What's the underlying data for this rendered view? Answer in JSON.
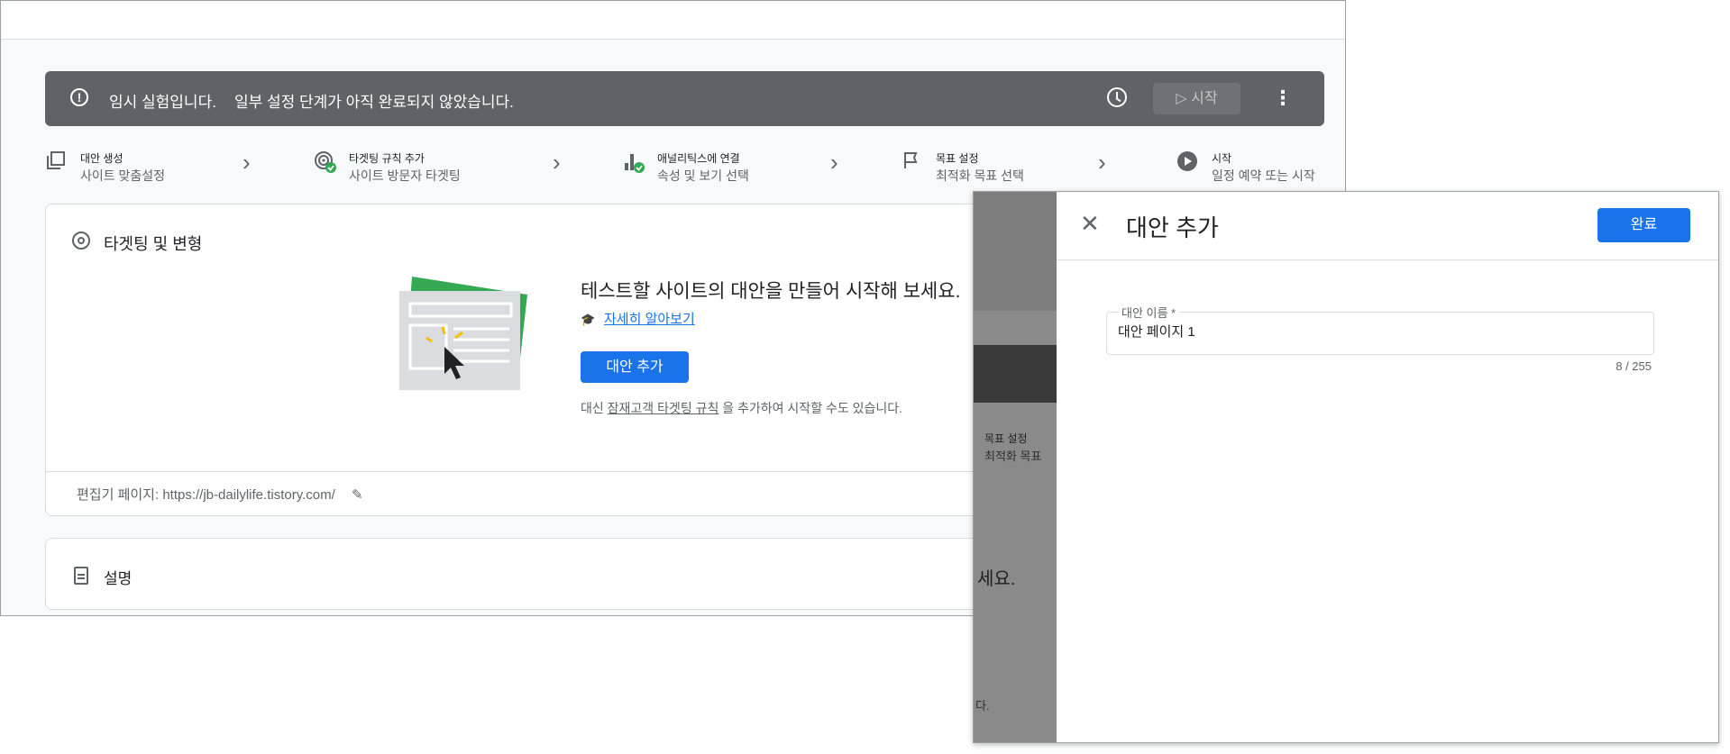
{
  "banner": {
    "message": "임시 실험입니다.",
    "message_detail": "일부 설정 단계가 아직 완료되지 않았습니다.",
    "start_label": "▷ 시작",
    "colors": {
      "background": "#5f6368"
    }
  },
  "steps": [
    {
      "title": "대안 생성",
      "subtitle": "사이트 맞춤설정",
      "icon": "copy-icon"
    },
    {
      "title": "타겟팅 규칙 추가",
      "subtitle": "사이트 방문자 타겟팅",
      "icon": "target-check-icon"
    },
    {
      "title": "애널리틱스에 연결",
      "subtitle": "속성 및 보기 선택",
      "icon": "analytics-check-icon"
    },
    {
      "title": "목표 설정",
      "subtitle": "최적화 목표 선택",
      "icon": "flag-icon"
    },
    {
      "title": "시작",
      "subtitle": "일정 예약 또는 시작",
      "icon": "play-circle-icon"
    }
  ],
  "targeting_card": {
    "title": "타겟팅 및 변형",
    "prompt": "테스트할 사이트의 대안을 만들어 시작해 보세요.",
    "learn_more": "자세히 알아보기",
    "add_button": "대안 추가",
    "alt_prefix": "대신",
    "alt_link": "잠재고객 타겟팅 규칙",
    "alt_suffix": "을 추가하여 시작할 수도 있습니다.",
    "editor_label": "편집기 페이지:",
    "editor_url": "https://jb-dailylife.tistory.com/"
  },
  "description_card": {
    "title": "설명"
  },
  "background_fragments": {
    "step_title": "목표 설정",
    "step_subtitle": "최적화 목표",
    "prompt_tail": "세요.",
    "text_tail": "다."
  },
  "dialog": {
    "title": "대안 추가",
    "done_button": "완료",
    "field_label": "대안 이름 *",
    "field_value": "대안 페이지 1",
    "counter": "8 / 255"
  },
  "colors": {
    "accent": "#1a73e8",
    "green": "#34a853"
  }
}
